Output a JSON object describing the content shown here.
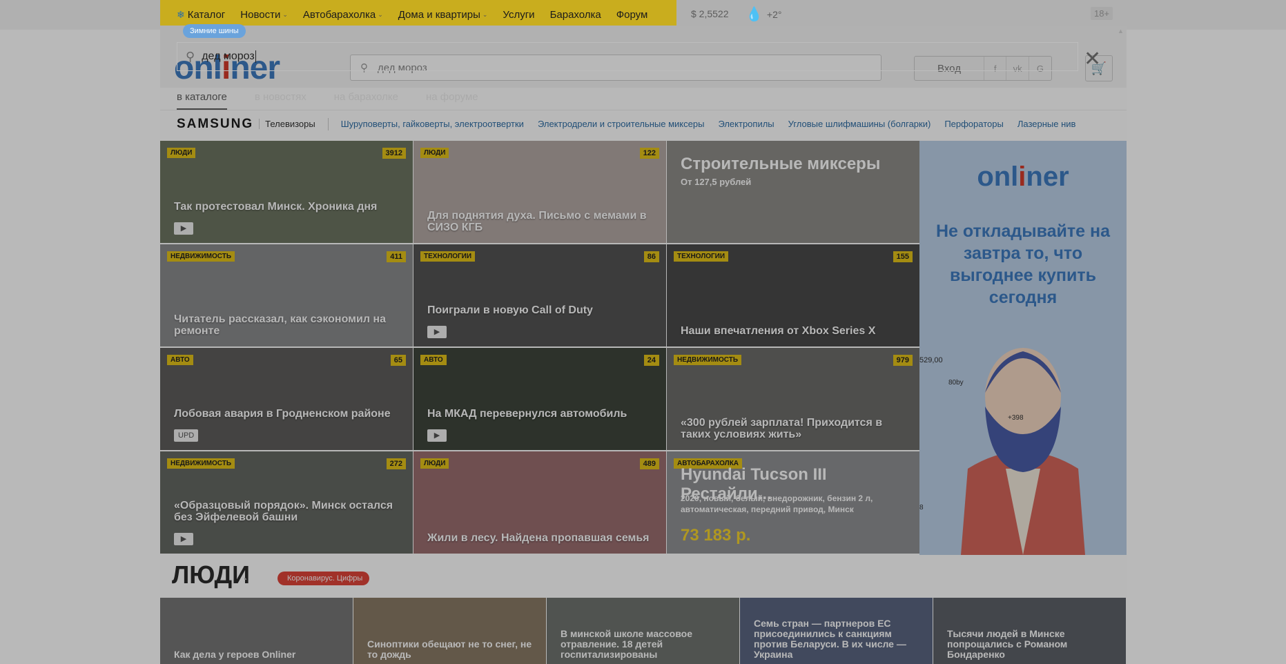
{
  "topnav": {
    "items": [
      "Каталог",
      "Новости",
      "Автобарахолка",
      "Дома и квартиры",
      "Услуги",
      "Барахолка",
      "Форум"
    ],
    "dropdown_flags": [
      false,
      true,
      true,
      true,
      false,
      false,
      false
    ],
    "rate": "$ 2,5522",
    "temperature": "+2°",
    "age": "18+"
  },
  "header": {
    "logo": "onliner",
    "search_placeholder": "дед мороз",
    "login": "Вход",
    "social": [
      "f",
      "vk",
      "G"
    ]
  },
  "search_overlay": {
    "badge": "Зимние шины",
    "query": "дед мороз",
    "tabs": [
      "в каталоге",
      "в новостях",
      "на барахолке",
      "на форуме"
    ],
    "active_tab": 0
  },
  "catalog_strip": {
    "brand": "SAMSUNG",
    "brand_category": "Телевизоры",
    "links": [
      "Шуруповерты, гайковерты, электроотвертки",
      "Электродрели и строительные миксеры",
      "Электропилы",
      "Угловые шлифмашины (болгарки)",
      "Перфораторы",
      "Лазерные нив"
    ]
  },
  "news": [
    {
      "badge": "Люди",
      "count": "3912",
      "title": "Так протестовал Минск. Хроника дня",
      "icon": "video",
      "bg": "#6d7562"
    },
    {
      "badge": "Люди",
      "count": "122",
      "title": "Для поднятия духа. Письмо с мемами в СИЗО КГБ",
      "icon": "",
      "bg": "#b3a8a4"
    },
    {
      "badge": "",
      "count": "",
      "title": "",
      "icon": "",
      "bg": "#8e8c88"
    },
    {
      "badge": "Недвижимость",
      "count": "411",
      "title": "Читатель рассказал, как сэкономил на ремонте",
      "icon": "",
      "bg": "#8a8b8d"
    },
    {
      "badge": "Технологии",
      "count": "86",
      "title": "Поиграли в новую Call of Duty",
      "icon": "video",
      "bg": "#545454"
    },
    {
      "badge": "Технологии",
      "count": "155",
      "title": "Наши впечатления от Xbox Series X",
      "icon": "",
      "bg": "#4a4a4a"
    },
    {
      "badge": "Авто",
      "count": "65",
      "title": "Лобовая авария в Гродненском районе",
      "icon": "upd",
      "bg": "#5f5e5c"
    },
    {
      "badge": "Авто",
      "count": "24",
      "title": "На МКАД перевернулся автомобиль",
      "icon": "video",
      "bg": "#3f463c"
    },
    {
      "badge": "Недвижимость",
      "count": "979",
      "title": "«300 рублей зарплата! Приходится в таких условиях жить»",
      "icon": "",
      "bg": "#6c6c6a"
    },
    {
      "badge": "Недвижимость",
      "count": "272",
      "title": "«Образцовый порядок». Минск остался без Эйфелевой башни",
      "icon": "video",
      "bg": "#656863"
    },
    {
      "badge": "Люди",
      "count": "489",
      "title": "Жили в лесу. Найдена пропавшая семья",
      "icon": "",
      "bg": "#9a6e70"
    },
    {
      "badge": "Автобарахолка",
      "count": "",
      "title": "",
      "icon": "",
      "bg": "#8f9093"
    }
  ],
  "promo_mixers": {
    "title": "Строительные миксеры",
    "sub": "От 127,5 рублей"
  },
  "promo_car": {
    "title": "Hyundai Tucson III Рестайли...",
    "spec": "2020, новый, белый, внедорожник, бензин 2 л, автоматическая, передний привод, Минск",
    "price": "73 183 р."
  },
  "upd_label": "UPD",
  "ad": {
    "logo": "onliner",
    "slogan": "Не откладывайте на завтра то, что выгоднее купить сегодня",
    "notes": [
      "529,00",
      "80by",
      "+398",
      "8"
    ]
  },
  "section": {
    "heading": "ЛЮДИ",
    "chip": "Коронавирус. Цифры",
    "tiles": [
      {
        "title": "Как дела у героев Onliner",
        "bg": "#777"
      },
      {
        "title": "Синоптики обещают не то снег, не то дождь",
        "bg": "#8a7a66"
      },
      {
        "title": "В минской школе массовое отравление. 18 детей госпитализированы",
        "bg": "#6f7470"
      },
      {
        "title": "Семь стран — партнеров ЕС присоединились к санкциям против Беларуси. В их числе — Украина",
        "bg": "#5a6682"
      },
      {
        "title": "Тысячи людей в Минске попрощались с Романом Бондаренко",
        "bg": "#5e6268"
      }
    ]
  }
}
